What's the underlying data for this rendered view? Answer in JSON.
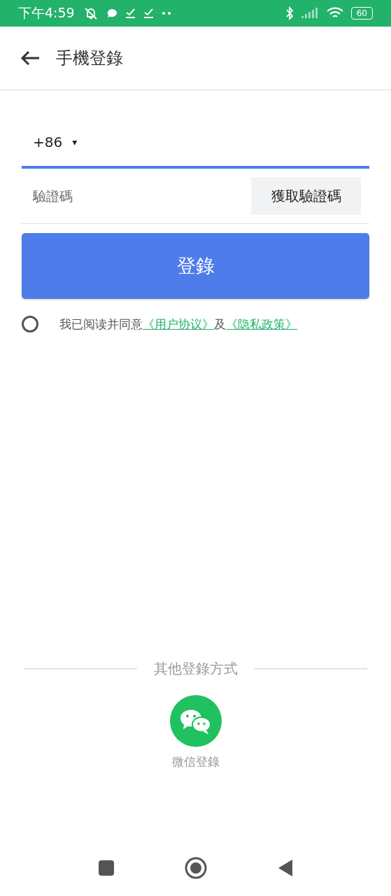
{
  "status_bar": {
    "time": "下午4:59",
    "battery": "60"
  },
  "header": {
    "title": "手機登錄"
  },
  "phone": {
    "country_code": "+86",
    "caret": "▾"
  },
  "code": {
    "placeholder": "驗證碼",
    "button": "獲取驗證碼"
  },
  "login_button": "登錄",
  "agreement": {
    "checked": false,
    "text": "我已阅读并同意",
    "link1": "《用户协议》",
    "joiner": "及",
    "link2": "《隐私政策》"
  },
  "other": {
    "title": "其他登錄方式",
    "wechat_label": "微信登錄"
  }
}
